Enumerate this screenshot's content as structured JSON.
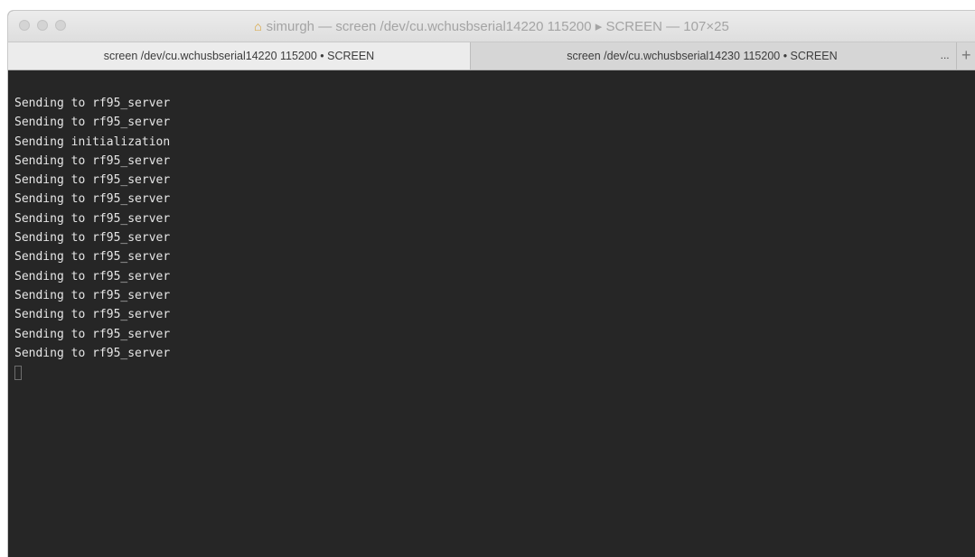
{
  "window": {
    "title": "simurgh — screen /dev/cu.wchusbserial14220 115200 ▸ SCREEN — 107×25",
    "title_icon": "home-icon"
  },
  "tabs": [
    {
      "label": "screen /dev/cu.wchusbserial14220 115200 • SCREEN",
      "active": true
    },
    {
      "label": "screen /dev/cu.wchusbserial14230 115200 • SCREEN",
      "active": false
    }
  ],
  "tab_overflow_label": "...",
  "tab_add_label": "+",
  "terminal": {
    "lines": [
      "Sending to rf95_server",
      "Sending to rf95_server",
      "Sending initialization",
      "Sending to rf95_server",
      "Sending to rf95_server",
      "Sending to rf95_server",
      "Sending to rf95_server",
      "Sending to rf95_server",
      "Sending to rf95_server",
      "Sending to rf95_server",
      "Sending to rf95_server",
      "Sending to rf95_server",
      "Sending to rf95_server",
      "Sending to rf95_server"
    ],
    "background": "#262626",
    "foreground": "#e6e6e6"
  }
}
